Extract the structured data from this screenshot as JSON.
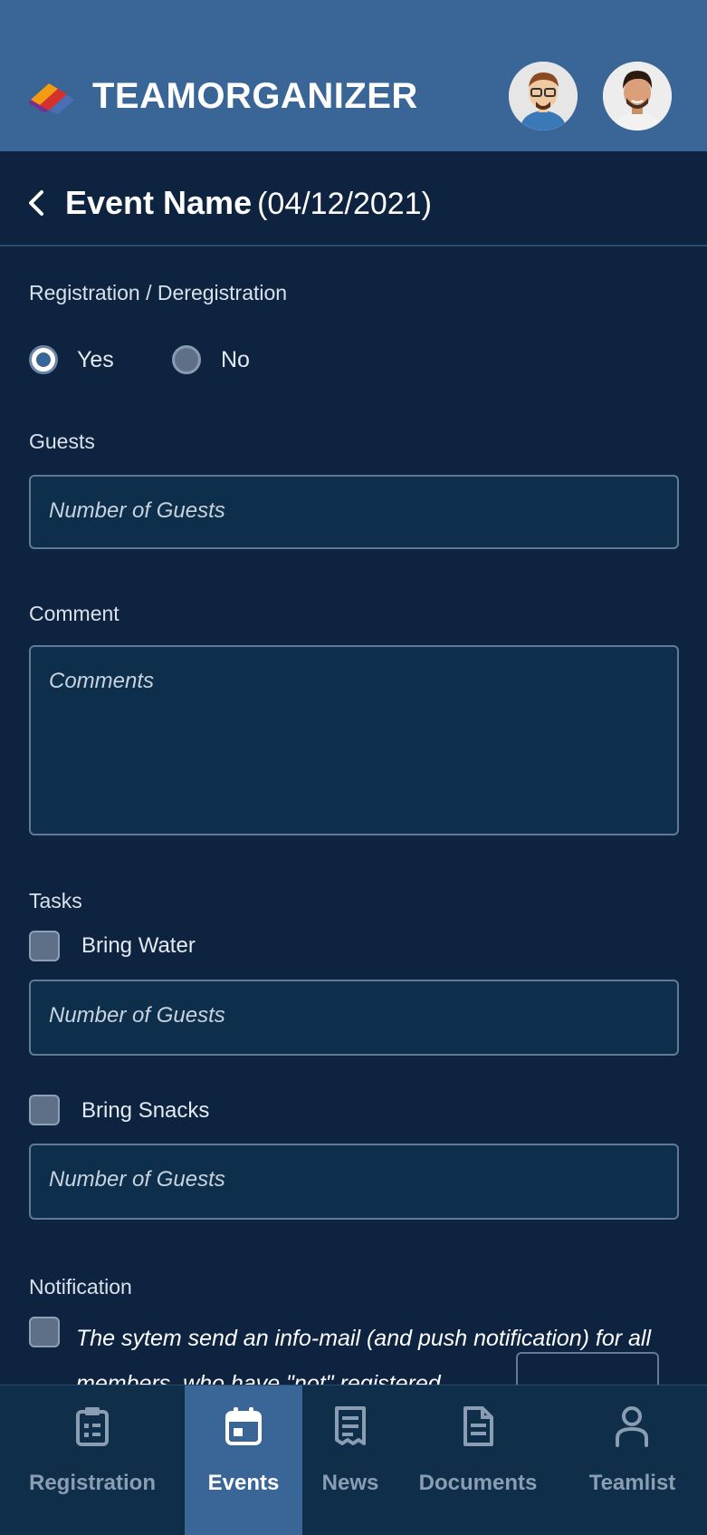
{
  "header": {
    "brand": "TEAMORGANIZER",
    "avatars": [
      "avatar-glasses-icon",
      "avatar-man-icon"
    ]
  },
  "titlebar": {
    "name": "Event Name",
    "date": "(04/12/2021)"
  },
  "registration": {
    "label": "Registration / Deregistration",
    "options": [
      {
        "label": "Yes",
        "checked": true
      },
      {
        "label": "No",
        "checked": false
      }
    ]
  },
  "guests": {
    "label": "Guests",
    "placeholder": "Number of Guests"
  },
  "comment": {
    "label": "Comment",
    "placeholder": "Comments"
  },
  "tasks": {
    "label": "Tasks",
    "items": [
      {
        "label": "Bring Water",
        "placeholder": "Number of Guests"
      },
      {
        "label": "Bring Snacks",
        "placeholder": "Number of Guests"
      }
    ]
  },
  "notification": {
    "label": "Notification",
    "text": "The sytem send an info-mail (and push notification) for all members, who have \"not\" registered"
  },
  "nav": {
    "items": [
      {
        "label": "Registration",
        "icon": "clipboard-icon",
        "active": false
      },
      {
        "label": "Events",
        "icon": "calendar-icon",
        "active": true
      },
      {
        "label": "News",
        "icon": "receipt-icon",
        "active": false
      },
      {
        "label": "Documents",
        "icon": "document-icon",
        "active": false
      },
      {
        "label": "Teamlist",
        "icon": "person-icon",
        "active": false
      }
    ]
  },
  "colors": {
    "header_bg": "#3a6597",
    "page_bg": "#0d2340",
    "field_bg": "#0e2f4c",
    "accent_orange": "#f39c12",
    "accent_red": "#d6312b",
    "accent_blue": "#4a6fb5"
  }
}
